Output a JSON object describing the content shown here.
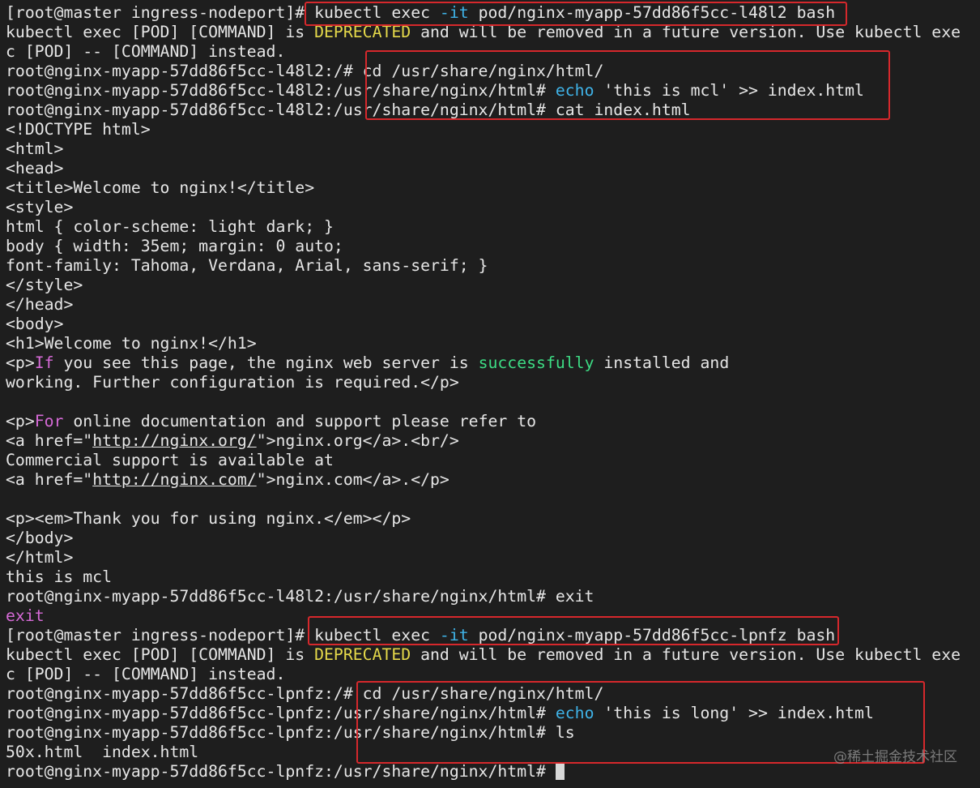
{
  "terminal": {
    "lines": [
      {
        "segs": [
          {
            "t": "[root@master ingress-nodeport]# kubectl exec "
          },
          {
            "t": "-it",
            "c": "cyan"
          },
          {
            "t": " pod/nginx-myapp-57dd86f5cc-l48l2 bash"
          }
        ]
      },
      {
        "segs": [
          {
            "t": "kubectl exec [POD] [COMMAND] is "
          },
          {
            "t": "DEPRECATED",
            "c": "yellow"
          },
          {
            "t": " and will be removed in a future version. Use kubectl exe"
          }
        ]
      },
      {
        "segs": [
          {
            "t": "c [POD] -- [COMMAND] instead."
          }
        ]
      },
      {
        "segs": [
          {
            "t": "root@nginx-myapp-57dd86f5cc-l48l2:/# cd /usr/share/nginx/html/"
          }
        ]
      },
      {
        "segs": [
          {
            "t": "root@nginx-myapp-57dd86f5cc-l48l2:/usr/share/nginx/html# "
          },
          {
            "t": "echo",
            "c": "cyan"
          },
          {
            "t": " 'this is mcl' >> index.html"
          }
        ]
      },
      {
        "segs": [
          {
            "t": "root@nginx-myapp-57dd86f5cc-l48l2:/usr/share/nginx/html# cat index.html"
          }
        ]
      },
      {
        "segs": [
          {
            "t": "<!DOCTYPE html>"
          }
        ]
      },
      {
        "segs": [
          {
            "t": "<html>"
          }
        ]
      },
      {
        "segs": [
          {
            "t": "<head>"
          }
        ]
      },
      {
        "segs": [
          {
            "t": "<title>Welcome to nginx!</title>"
          }
        ]
      },
      {
        "segs": [
          {
            "t": "<style>"
          }
        ]
      },
      {
        "segs": [
          {
            "t": "html { color-scheme: light dark; }"
          }
        ]
      },
      {
        "segs": [
          {
            "t": "body { width: 35em; margin: 0 auto;"
          }
        ]
      },
      {
        "segs": [
          {
            "t": "font-family: Tahoma, Verdana, Arial, sans-serif; }"
          }
        ]
      },
      {
        "segs": [
          {
            "t": "</style>"
          }
        ]
      },
      {
        "segs": [
          {
            "t": "</head>"
          }
        ]
      },
      {
        "segs": [
          {
            "t": "<body>"
          }
        ]
      },
      {
        "segs": [
          {
            "t": "<h1>Welcome to nginx!</h1>"
          }
        ]
      },
      {
        "segs": [
          {
            "t": "<p>"
          },
          {
            "t": "If",
            "c": "magenta"
          },
          {
            "t": " you see this page, the nginx web server is "
          },
          {
            "t": "successfully",
            "c": "green"
          },
          {
            "t": " installed and"
          }
        ]
      },
      {
        "segs": [
          {
            "t": "working. Further configuration is required.</p>"
          }
        ]
      },
      {
        "segs": [
          {
            "t": ""
          }
        ]
      },
      {
        "segs": [
          {
            "t": "<p>"
          },
          {
            "t": "For",
            "c": "magenta"
          },
          {
            "t": " online documentation and support please refer to"
          }
        ]
      },
      {
        "segs": [
          {
            "t": "<a href=\""
          },
          {
            "t": "http://nginx.org/",
            "c": "link"
          },
          {
            "t": "\">nginx.org</a>.<br/>"
          }
        ]
      },
      {
        "segs": [
          {
            "t": "Commercial support is available at"
          }
        ]
      },
      {
        "segs": [
          {
            "t": "<a href=\""
          },
          {
            "t": "http://nginx.com/",
            "c": "link"
          },
          {
            "t": "\">nginx.com</a>.</p>"
          }
        ]
      },
      {
        "segs": [
          {
            "t": ""
          }
        ]
      },
      {
        "segs": [
          {
            "t": "<p><em>Thank you for using nginx.</em></p>"
          }
        ]
      },
      {
        "segs": [
          {
            "t": "</body>"
          }
        ]
      },
      {
        "segs": [
          {
            "t": "</html>"
          }
        ]
      },
      {
        "segs": [
          {
            "t": "this is mcl"
          }
        ]
      },
      {
        "segs": [
          {
            "t": "root@nginx-myapp-57dd86f5cc-l48l2:/usr/share/nginx/html# exit"
          }
        ]
      },
      {
        "segs": [
          {
            "t": "exit",
            "c": "magenta"
          }
        ]
      },
      {
        "segs": [
          {
            "t": "[root@master ingress-nodeport]# kubectl exec "
          },
          {
            "t": "-it",
            "c": "cyan"
          },
          {
            "t": " pod/nginx-myapp-57dd86f5cc-lpnfz bash"
          }
        ]
      },
      {
        "segs": [
          {
            "t": "kubectl exec [POD] [COMMAND] is "
          },
          {
            "t": "DEPRECATED",
            "c": "yellow"
          },
          {
            "t": " and will be removed in a future version. Use kubectl exe"
          }
        ]
      },
      {
        "segs": [
          {
            "t": "c [POD] -- [COMMAND] instead."
          }
        ]
      },
      {
        "segs": [
          {
            "t": "root@nginx-myapp-57dd86f5cc-lpnfz:/# cd /usr/share/nginx/html/"
          }
        ]
      },
      {
        "segs": [
          {
            "t": "root@nginx-myapp-57dd86f5cc-lpnfz:/usr/share/nginx/html# "
          },
          {
            "t": "echo",
            "c": "cyan"
          },
          {
            "t": " 'this is long' >> index.html"
          }
        ]
      },
      {
        "segs": [
          {
            "t": "root@nginx-myapp-57dd86f5cc-lpnfz:/usr/share/nginx/html# ls"
          }
        ]
      },
      {
        "segs": [
          {
            "t": "50x.html  index.html"
          }
        ]
      },
      {
        "segs": [
          {
            "t": "root@nginx-myapp-57dd86f5cc-lpnfz:/usr/share/nginx/html# "
          }
        ],
        "cursor": true
      }
    ]
  },
  "colors": {
    "background": "#1e1e1e",
    "text": "#e6e6e6",
    "yellow": "#e5d94a",
    "cyan": "#3fb3e8",
    "magenta": "#d56ad6",
    "green": "#3ddc84",
    "highlight_box": "#d6282c"
  },
  "watermark": "@稀土掘金技术社区"
}
